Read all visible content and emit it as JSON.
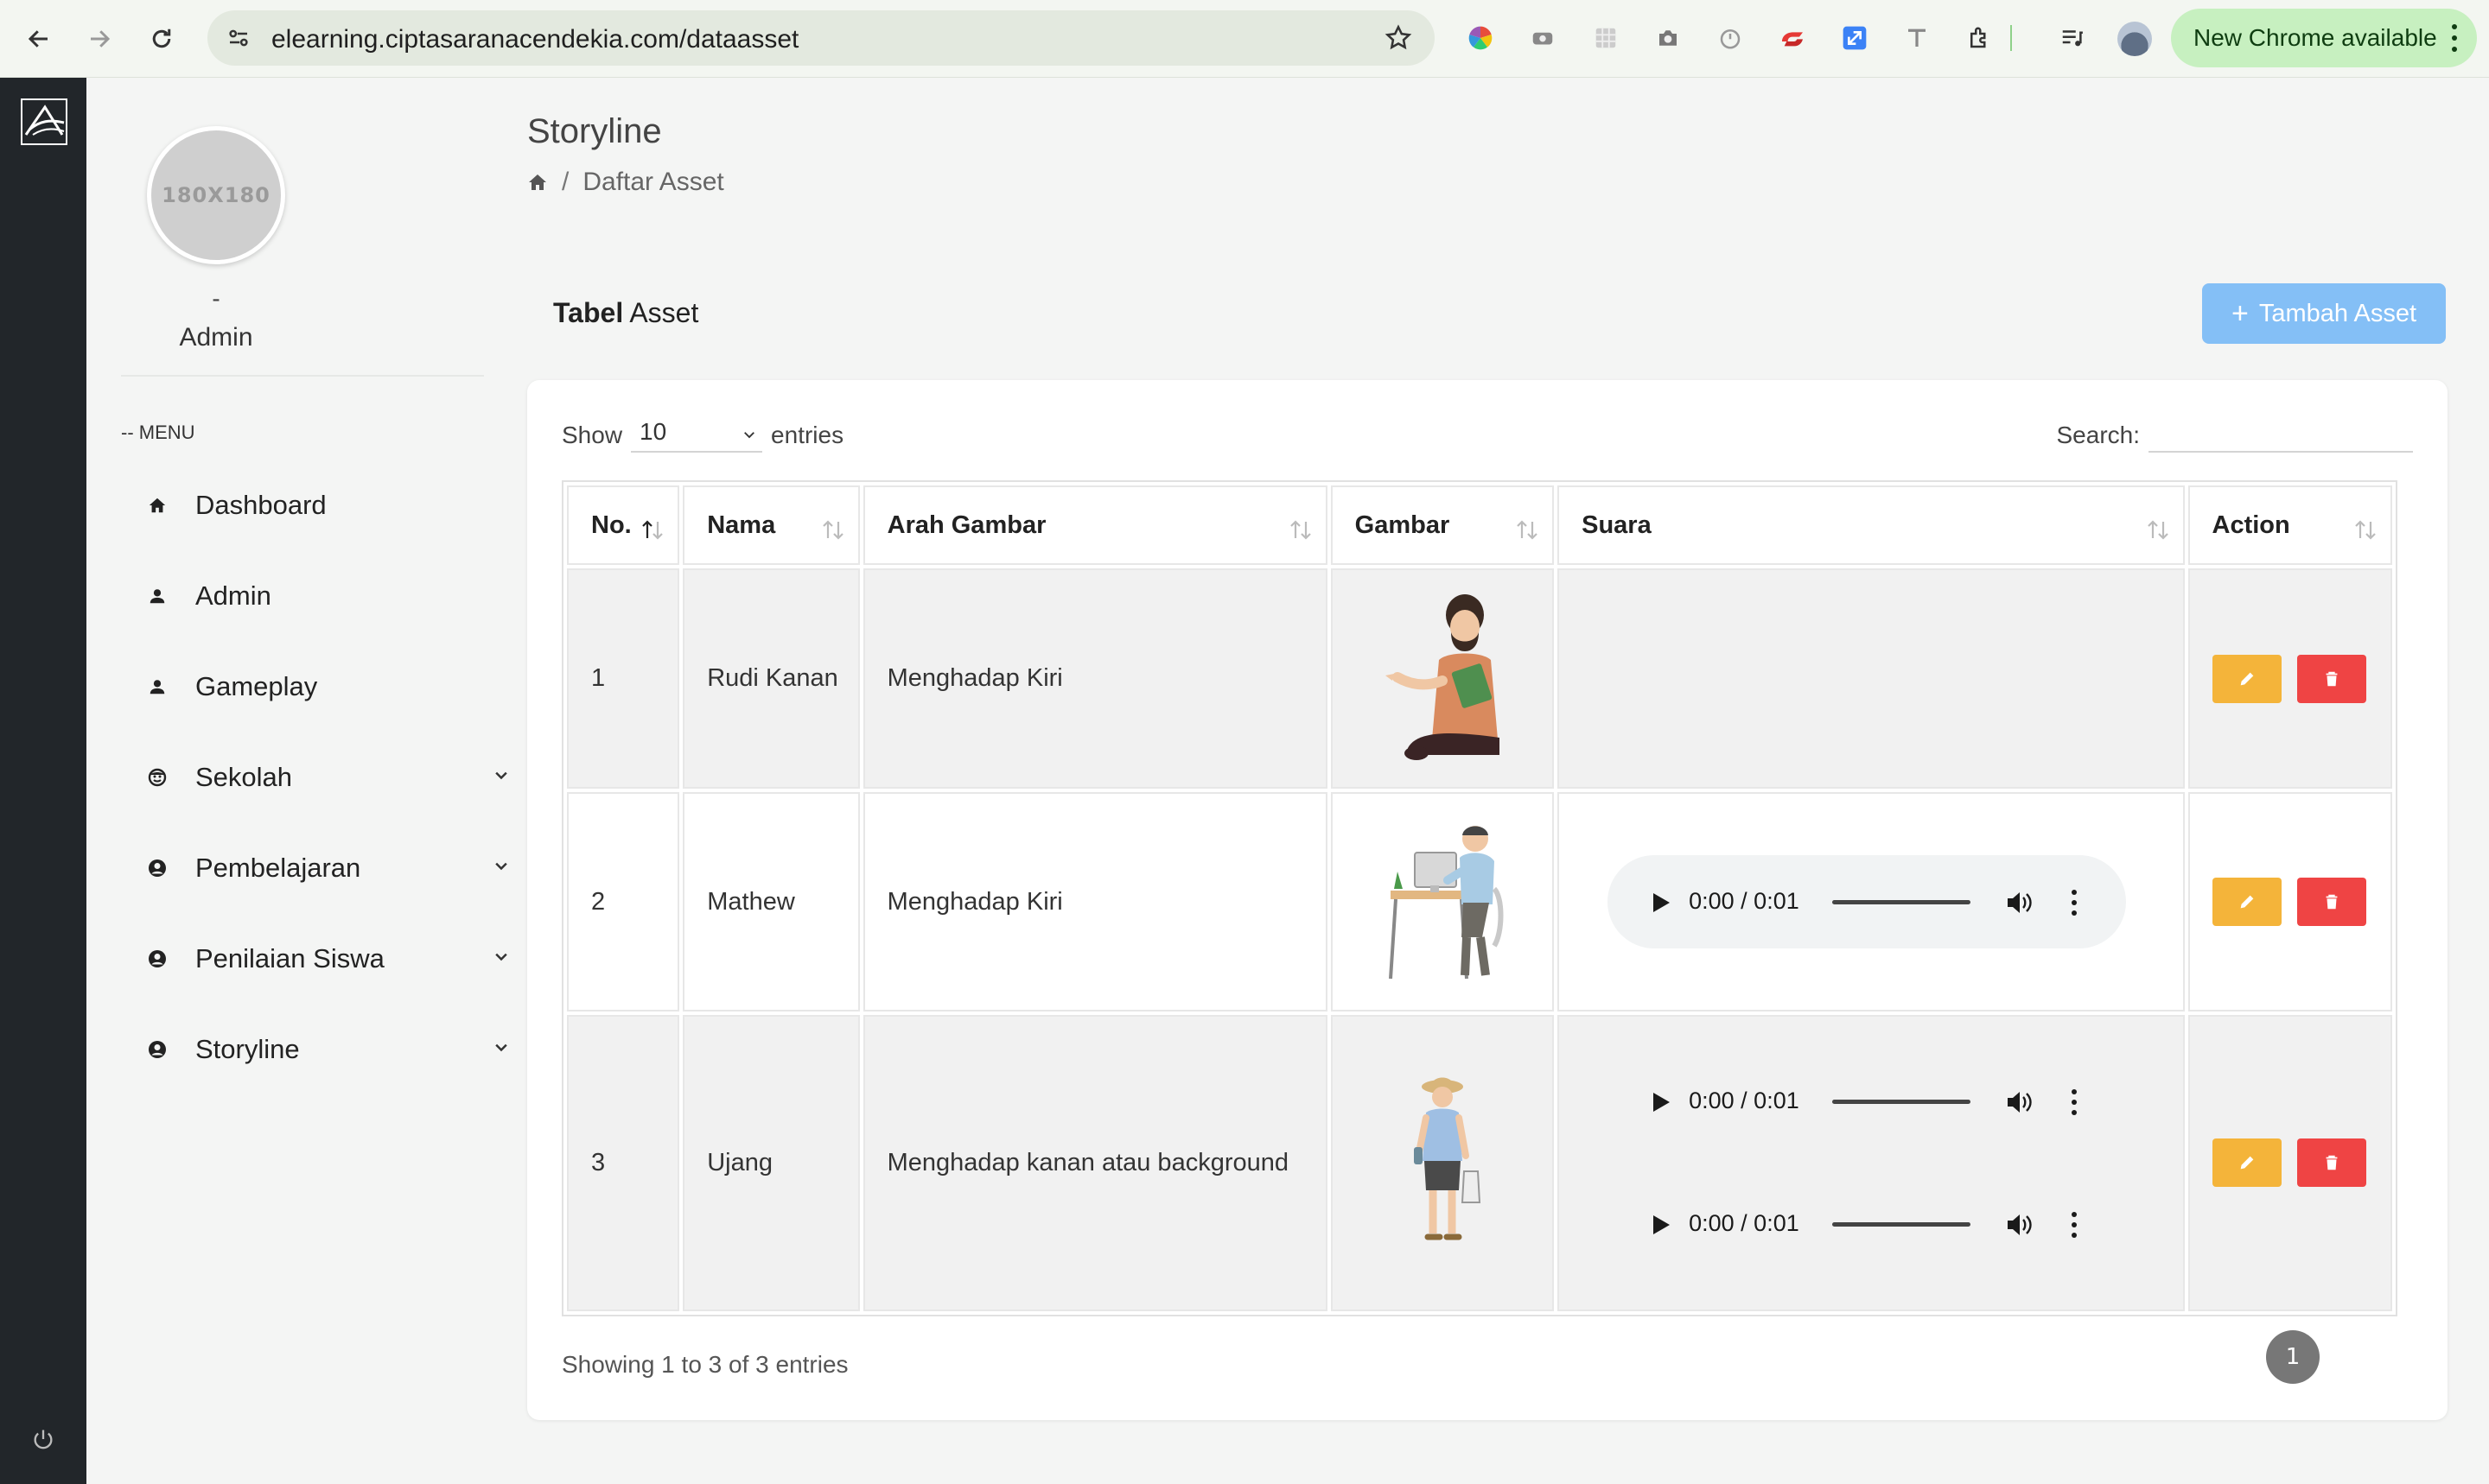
{
  "browser": {
    "url": "elearning.ciptasaranacendekia.com/dataasset",
    "update_label": "New Chrome available"
  },
  "sidebar": {
    "profile_placeholder": "180X180",
    "profile_name": "-",
    "profile_role": "Admin",
    "menu_heading": "-- MENU",
    "items": [
      {
        "label": "Dashboard",
        "icon": "home-icon"
      },
      {
        "label": "Admin",
        "icon": "user-icon"
      },
      {
        "label": "Gameplay",
        "icon": "user-icon"
      },
      {
        "label": "Sekolah",
        "icon": "school-icon"
      },
      {
        "label": "Pembelajaran",
        "icon": "user-circle-icon"
      },
      {
        "label": "Penilaian Siswa",
        "icon": "user-circle-icon"
      },
      {
        "label": "Storyline",
        "icon": "user-circle-icon"
      }
    ]
  },
  "header": {
    "title": "Storyline",
    "breadcrumb_sep": "/",
    "breadcrumb_current": "Daftar Asset"
  },
  "section": {
    "title_bold": "Tabel",
    "title_rest": "Asset",
    "add_button": "Tambah Asset"
  },
  "table": {
    "show_label": "Show",
    "entries_value": "10",
    "entries_label": "entries",
    "search_label": "Search:",
    "columns": [
      "No.",
      "Nama",
      "Arah Gambar",
      "Gambar",
      "Suara",
      "Action"
    ],
    "rows": [
      {
        "no": "1",
        "nama": "Rudi Kanan",
        "arah": "Menghadap Kiri",
        "audio": []
      },
      {
        "no": "2",
        "nama": "Mathew",
        "arah": "Menghadap Kiri",
        "audio": [
          "0:00 / 0:01"
        ]
      },
      {
        "no": "3",
        "nama": "Ujang",
        "arah": "Menghadap kanan atau background",
        "audio": [
          "0:00 / 0:01",
          "0:00 / 0:01"
        ]
      }
    ],
    "info": "Showing 1 to 3 of 3 entries",
    "current_page": "1"
  },
  "colors": {
    "edit": "#f4b43a",
    "delete": "#ef4444",
    "primary": "#84bff6",
    "sidebar_dark": "#22262a"
  }
}
